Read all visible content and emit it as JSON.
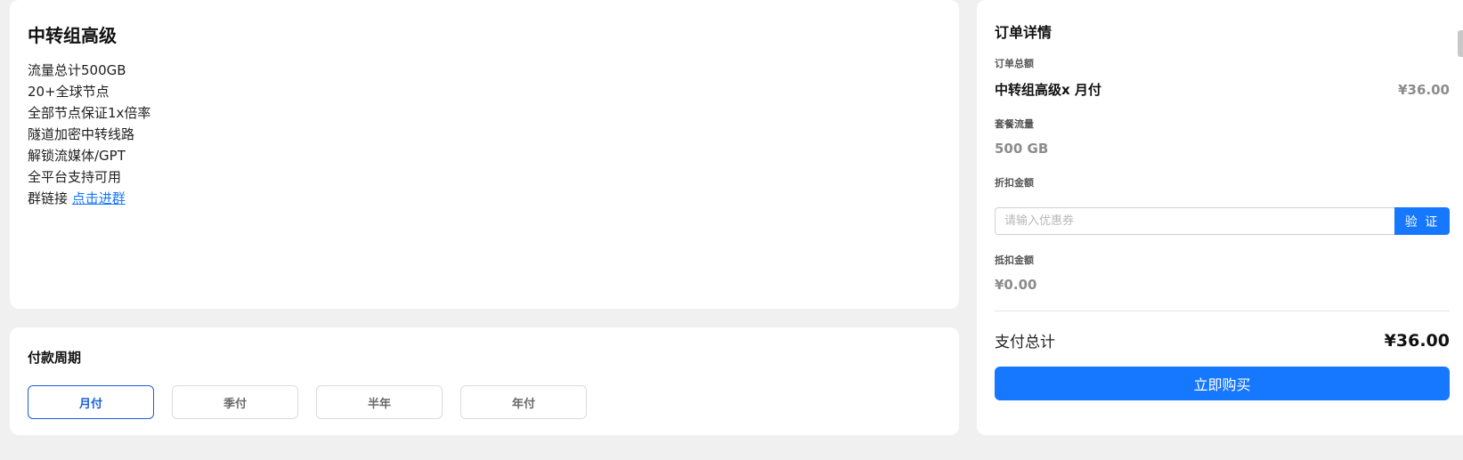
{
  "plan": {
    "title": "中转组高级",
    "features": [
      "流量总计500GB",
      "20+全球节点",
      "全部节点保证1x倍率",
      "隧道加密中转线路",
      "解锁流媒体/GPT",
      "全平台支持可用"
    ],
    "group_label": "群链接",
    "group_link": "点击进群"
  },
  "period": {
    "title": "付款周期",
    "options": [
      "月付",
      "季付",
      "半年",
      "年付"
    ],
    "selected": "月付"
  },
  "order": {
    "title": "订单详情",
    "total_label": "订单总额",
    "item_name": "中转组高级x 月付",
    "item_price": "¥36.00",
    "traffic_label": "套餐流量",
    "traffic_value": "500 GB",
    "discount_label": "折扣金额",
    "coupon_placeholder": "请输入优惠券",
    "verify_label": "验 证",
    "deduct_label": "抵扣金额",
    "deduct_value": "¥0.00",
    "pay_total_label": "支付总计",
    "pay_total_value": "¥36.00",
    "buy_label": "立即购买"
  },
  "colors": {
    "accent": "#1677ff",
    "selected_border": "#1d5fd6",
    "background": "#f0f0f0"
  }
}
